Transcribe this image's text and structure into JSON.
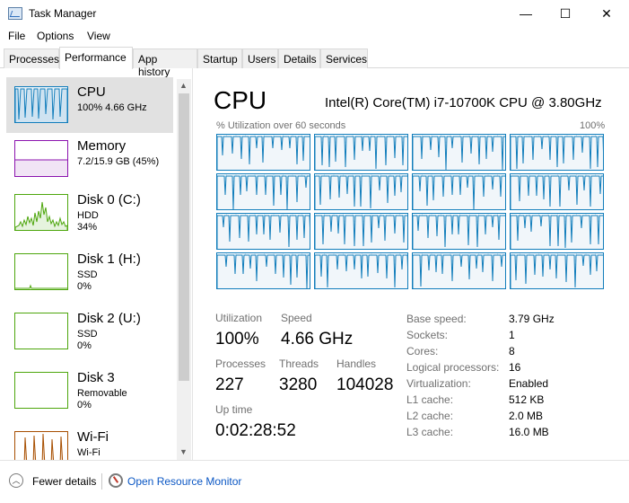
{
  "window": {
    "title": "Task Manager",
    "controls": {
      "minimize": "—",
      "maximize": "☐",
      "close": "✕"
    }
  },
  "menu": [
    "File",
    "Options",
    "View"
  ],
  "tabs": [
    "Processes",
    "Performance",
    "App history",
    "Startup",
    "Users",
    "Details",
    "Services"
  ],
  "active_tab": "Performance",
  "sidebar": {
    "items": [
      {
        "name": "CPU",
        "line2": "100%  4.66 GHz",
        "line3": "",
        "color": "#117dbb"
      },
      {
        "name": "Memory",
        "line2": "7.2/15.9 GB (45%)",
        "line3": "",
        "color": "#8b12ae"
      },
      {
        "name": "Disk 0 (C:)",
        "line2": "HDD",
        "line3": "34%",
        "color": "#4da60c"
      },
      {
        "name": "Disk 1 (H:)",
        "line2": "SSD",
        "line3": "0%",
        "color": "#4da60c"
      },
      {
        "name": "Disk 2 (U:)",
        "line2": "SSD",
        "line3": "0%",
        "color": "#4da60c"
      },
      {
        "name": "Disk 3",
        "line2": "Removable",
        "line3": "0%",
        "color": "#4da60c"
      },
      {
        "name": "Wi-Fi",
        "line2": "Wi-Fi",
        "line3": "",
        "color": "#a74f01"
      }
    ]
  },
  "cpu_panel": {
    "title": "CPU",
    "cpu_name": "Intel(R) Core(TM) i7-10700K CPU @ 3.80GHz",
    "graph_caption": "% Utilization over 60 seconds",
    "graph_max": "100%",
    "utilization_label": "Utilization",
    "utilization": "100%",
    "speed_label": "Speed",
    "speed": "4.66 GHz",
    "processes_label": "Processes",
    "processes": "227",
    "threads_label": "Threads",
    "threads": "3280",
    "handles_label": "Handles",
    "handles": "104028",
    "uptime_label": "Up time",
    "uptime": "0:02:28:52",
    "details": [
      {
        "label": "Base speed:",
        "value": "3.79 GHz"
      },
      {
        "label": "Sockets:",
        "value": "1"
      },
      {
        "label": "Cores:",
        "value": "8"
      },
      {
        "label": "Logical processors:",
        "value": "16"
      },
      {
        "label": "Virtualization:",
        "value": "Enabled"
      },
      {
        "label": "L1 cache:",
        "value": "512 KB"
      },
      {
        "label": "L2 cache:",
        "value": "2.0 MB"
      },
      {
        "label": "L3 cache:",
        "value": "16.0 MB"
      }
    ]
  },
  "footer": {
    "fewer_details": "Fewer details",
    "open_resource_monitor": "Open Resource Monitor"
  },
  "colors": {
    "cpu_line": "#117dbb",
    "memory_line": "#8b12ae",
    "disk_line": "#4da60c",
    "wifi_line": "#a74f01",
    "link": "#0b57c4"
  }
}
